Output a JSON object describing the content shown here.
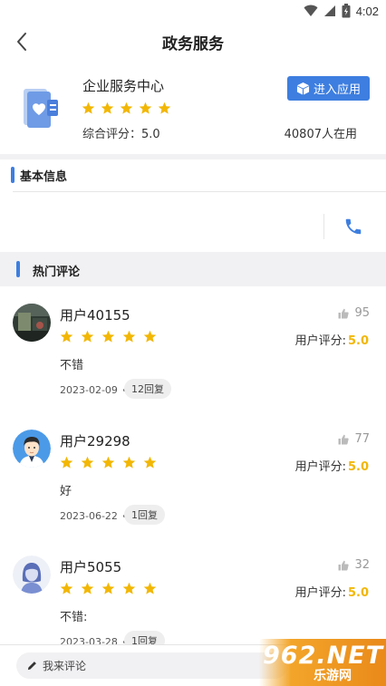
{
  "status_bar": {
    "time": "4:02"
  },
  "nav": {
    "title": "政务服务"
  },
  "app": {
    "name": "企业服务中心",
    "stars": 5,
    "score_text": "综合评分：5.0",
    "enter_label": "进入应用",
    "users_text": "40807人在用",
    "accent_color": "#3d7ee0"
  },
  "info": {
    "title": "基本信息"
  },
  "hot_comments": {
    "title": "热门评论"
  },
  "comments": [
    {
      "user": "用户40155",
      "stars": 5,
      "likes": "95",
      "rating_label": "用户评分:",
      "rating": "5.0",
      "text": "不错",
      "date": "2023-02-09",
      "replies": "12回复",
      "avatar": "photo-avatar"
    },
    {
      "user": "用户29298",
      "stars": 5,
      "likes": "77",
      "rating_label": "用户评分:",
      "rating": "5.0",
      "text": "好",
      "date": "2023-06-22",
      "replies": "1回复",
      "avatar": "male-avatar"
    },
    {
      "user": "用户5055",
      "stars": 5,
      "likes": "32",
      "rating_label": "用户评分:",
      "rating": "5.0",
      "text": "不错:",
      "date": "2023-03-28",
      "replies": "1回复",
      "avatar": "female-avatar"
    }
  ],
  "bottom": {
    "comment_placeholder": "我来评论"
  },
  "watermark": {
    "logo": "962.NET",
    "sub": "乐游网"
  },
  "colors": {
    "star": "#f2b705",
    "rating": "#f2b705",
    "phone": "#3d7ee0"
  }
}
